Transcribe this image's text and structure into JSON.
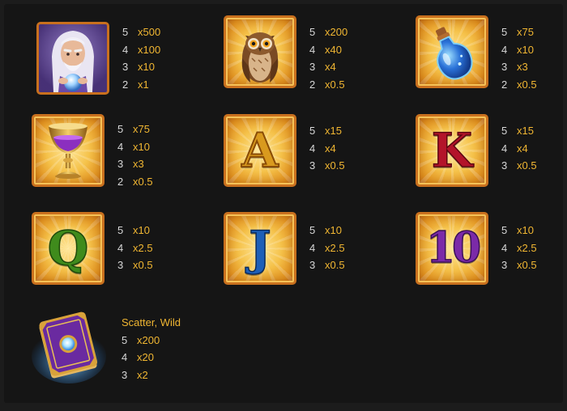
{
  "symbols": [
    {
      "name": "Wizard",
      "icon": "wizard-icon",
      "pays": [
        {
          "count": "5",
          "mult": "x500"
        },
        {
          "count": "4",
          "mult": "x100"
        },
        {
          "count": "3",
          "mult": "x10"
        },
        {
          "count": "2",
          "mult": "x1"
        }
      ]
    },
    {
      "name": "Owl",
      "icon": "owl-icon",
      "pays": [
        {
          "count": "5",
          "mult": "x200"
        },
        {
          "count": "4",
          "mult": "x40"
        },
        {
          "count": "3",
          "mult": "x4"
        },
        {
          "count": "2",
          "mult": "x0.5"
        }
      ]
    },
    {
      "name": "Potion",
      "icon": "potion-bottle-icon",
      "pays": [
        {
          "count": "5",
          "mult": "x75"
        },
        {
          "count": "4",
          "mult": "x10"
        },
        {
          "count": "3",
          "mult": "x3"
        },
        {
          "count": "2",
          "mult": "x0.5"
        }
      ]
    },
    {
      "name": "Goblet",
      "icon": "goblet-icon",
      "pays": [
        {
          "count": "5",
          "mult": "x75"
        },
        {
          "count": "4",
          "mult": "x10"
        },
        {
          "count": "3",
          "mult": "x3"
        },
        {
          "count": "2",
          "mult": "x0.5"
        }
      ]
    },
    {
      "name": "A",
      "glyph": "A",
      "color": "#d99a1e",
      "pays": [
        {
          "count": "5",
          "mult": "x15"
        },
        {
          "count": "4",
          "mult": "x4"
        },
        {
          "count": "3",
          "mult": "x0.5"
        }
      ]
    },
    {
      "name": "K",
      "glyph": "K",
      "color": "#b3142a",
      "pays": [
        {
          "count": "5",
          "mult": "x15"
        },
        {
          "count": "4",
          "mult": "x4"
        },
        {
          "count": "3",
          "mult": "x0.5"
        }
      ]
    },
    {
      "name": "Q",
      "glyph": "Q",
      "color": "#3f8b1c",
      "pays": [
        {
          "count": "5",
          "mult": "x10"
        },
        {
          "count": "4",
          "mult": "x2.5"
        },
        {
          "count": "3",
          "mult": "x0.5"
        }
      ]
    },
    {
      "name": "J",
      "glyph": "J",
      "color": "#1d5fb8",
      "pays": [
        {
          "count": "5",
          "mult": "x10"
        },
        {
          "count": "4",
          "mult": "x2.5"
        },
        {
          "count": "3",
          "mult": "x0.5"
        }
      ]
    },
    {
      "name": "10",
      "glyph": "10",
      "color": "#7b2aa8",
      "pays": [
        {
          "count": "5",
          "mult": "x10"
        },
        {
          "count": "4",
          "mult": "x2.5"
        },
        {
          "count": "3",
          "mult": "x0.5"
        }
      ]
    },
    {
      "name": "Book",
      "icon": "spell-book-icon",
      "caption": "Scatter, Wild",
      "pays": [
        {
          "count": "5",
          "mult": "x200"
        },
        {
          "count": "4",
          "mult": "x20"
        },
        {
          "count": "3",
          "mult": "x2"
        }
      ]
    }
  ],
  "colors": {
    "background": "#151515",
    "multiplier": "#f0b632",
    "count": "#d7d7d7",
    "tile_border": "#c9701e"
  }
}
